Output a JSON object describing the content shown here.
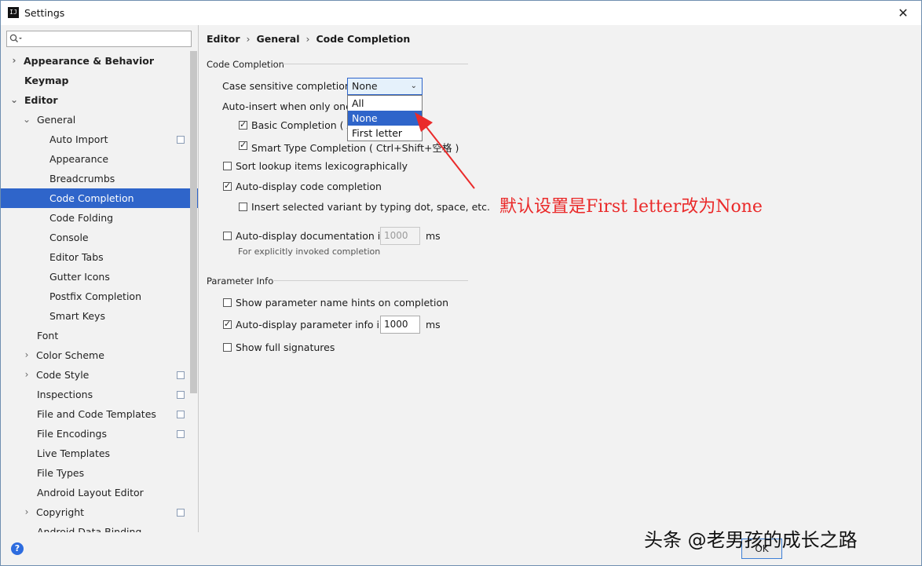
{
  "window": {
    "title": "Settings",
    "close_glyph": "✕"
  },
  "sidebar": {
    "search_placeholder": "",
    "items": [
      {
        "label": "Appearance & Behavior"
      },
      {
        "label": "Keymap"
      },
      {
        "label": "Editor"
      },
      {
        "label": "General"
      },
      {
        "label": "Auto Import"
      },
      {
        "label": "Appearance"
      },
      {
        "label": "Breadcrumbs"
      },
      {
        "label": "Code Completion"
      },
      {
        "label": "Code Folding"
      },
      {
        "label": "Console"
      },
      {
        "label": "Editor Tabs"
      },
      {
        "label": "Gutter Icons"
      },
      {
        "label": "Postfix Completion"
      },
      {
        "label": "Smart Keys"
      },
      {
        "label": "Font"
      },
      {
        "label": "Color Scheme"
      },
      {
        "label": "Code Style"
      },
      {
        "label": "Inspections"
      },
      {
        "label": "File and Code Templates"
      },
      {
        "label": "File Encodings"
      },
      {
        "label": "Live Templates"
      },
      {
        "label": "File Types"
      },
      {
        "label": "Android Layout Editor"
      },
      {
        "label": "Copyright"
      },
      {
        "label": "Android Data Binding"
      }
    ]
  },
  "breadcrumb": {
    "items": [
      "Editor",
      "General",
      "Code Completion"
    ],
    "separator": "›"
  },
  "code_completion": {
    "section_title": "Code Completion",
    "case_sensitive_label": "Case sensitive completion:",
    "case_sensitive_value": "None",
    "case_sensitive_options": [
      "All",
      "None",
      "First letter"
    ],
    "auto_insert_label": "Auto-insert when only one c",
    "basic_completion": {
      "label": "Basic Completion ( A",
      "checked": true
    },
    "smart_type_completion": {
      "label": "Smart Type Completion ( Ctrl+Shift+空格 )",
      "checked": true
    },
    "sort_lexico": {
      "label": "Sort lookup items lexicographically",
      "checked": false
    },
    "auto_display": {
      "label": "Auto-display code completion",
      "checked": true
    },
    "insert_variant": {
      "label": "Insert selected variant by typing dot, space, etc.",
      "checked": false
    },
    "auto_doc": {
      "label": "Auto-display documentation in",
      "checked": false,
      "value": "1000",
      "unit": "ms"
    },
    "auto_doc_hint": "For explicitly invoked completion"
  },
  "parameter_info": {
    "section_title": "Parameter Info",
    "show_hints": {
      "label": "Show parameter name hints on completion",
      "checked": false
    },
    "auto_display": {
      "label": "Auto-display parameter info in",
      "checked": true,
      "value": "1000",
      "unit": "ms"
    },
    "full_signatures": {
      "label": "Show full signatures",
      "checked": false
    }
  },
  "annotation": {
    "text": "默认设置是First letter改为None",
    "color": "#ea2a2a"
  },
  "footer": {
    "ok_label": "OK",
    "help_glyph": "?"
  },
  "watermark": {
    "text": "头条 @老男孩的成长之路"
  }
}
